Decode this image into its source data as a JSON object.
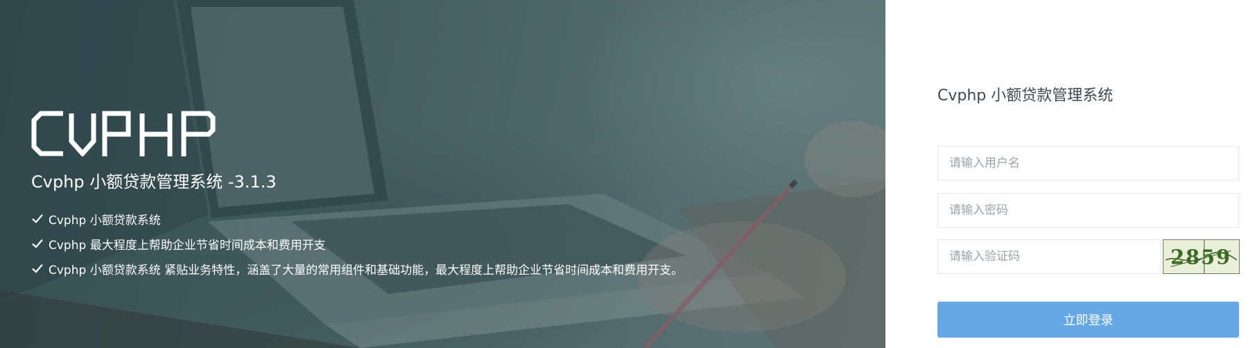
{
  "hero": {
    "logo_text": "CVPHP",
    "title": "Cvphp 小额贷款管理系统 -3.1.3",
    "features": [
      {
        "icon": "check-icon",
        "text": "Cvphp 小额贷款系统"
      },
      {
        "icon": "check-icon",
        "text": "Cvphp 最大程度上帮助企业节省时间成本和费用开支"
      },
      {
        "icon": "check-icon",
        "text": "Cvphp 小额贷款系统 紧贴业务特性，涵盖了大量的常用组件和基础功能，最大程度上帮助企业节省时间成本和费用开支。"
      }
    ]
  },
  "login": {
    "title": "Cvphp 小额贷款管理系统",
    "username_placeholder": "请输入用户名",
    "password_placeholder": "请输入密码",
    "captcha_placeholder": "请输入验证码",
    "captcha_text": "2859",
    "submit_label": "立即登录"
  },
  "colors": {
    "primary_button": "#66a8e6",
    "title_text": "#3d4852",
    "placeholder_text": "#9aa3ad",
    "hero_overlay": "#3c5559"
  }
}
